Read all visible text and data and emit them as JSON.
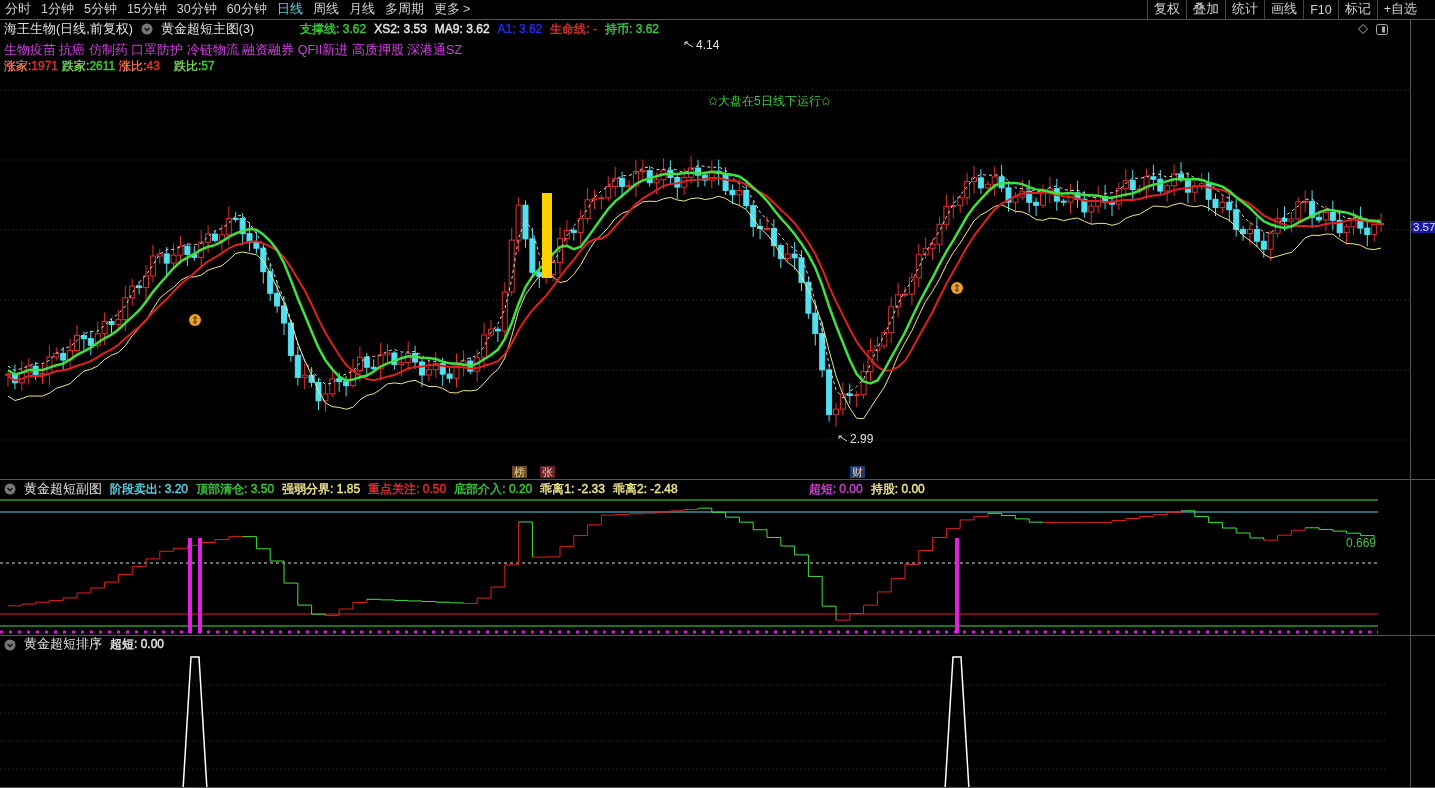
{
  "period_tabs": [
    {
      "label": "分时",
      "selected": false
    },
    {
      "label": "1分钟",
      "selected": false
    },
    {
      "label": "5分钟",
      "selected": false
    },
    {
      "label": "15分钟",
      "selected": false
    },
    {
      "label": "30分钟",
      "selected": false
    },
    {
      "label": "60分钟",
      "selected": false
    },
    {
      "label": "日线",
      "selected": true
    },
    {
      "label": "周线",
      "selected": false
    },
    {
      "label": "月线",
      "selected": false
    },
    {
      "label": "多周期",
      "selected": false
    },
    {
      "label": "更多 >",
      "selected": false
    }
  ],
  "toolbar_buttons": [
    "复权",
    "叠加",
    "统计",
    "画线",
    "F10",
    "标记",
    "+自选"
  ],
  "main_chart": {
    "stock_title": "海王生物(日线,前复权)",
    "indicator_name": "黄金超短主图(3)",
    "legend": [
      {
        "label": "支撑线:",
        "value": "3.62",
        "color": "#3cc83c"
      },
      {
        "label": "XS2:",
        "value": "3.53",
        "color": "#e6e6e6"
      },
      {
        "label": "MA9:",
        "value": "3.62",
        "color": "#e6e6e6"
      },
      {
        "label": "A1:",
        "value": "3.62",
        "color": "#2a2ae6"
      },
      {
        "label": "生命线:",
        "value": "-",
        "color": "#e03030"
      },
      {
        "label": "持币:",
        "value": "3.62",
        "color": "#3cc83c"
      }
    ],
    "concepts": "生物疫苗 抗癌 仿制药 口罩防护 冷链物流 融资融券 QFII新进 高质押股 深港通SZ",
    "breadth": [
      {
        "label": "涨家:",
        "value": "1971",
        "color": "#e03030"
      },
      {
        "label": "跌家:",
        "value": "2611",
        "color": "#3cc83c"
      },
      {
        "label": "涨比:",
        "value": "43",
        "color": "#e03030"
      },
      {
        "label": "跌比:",
        "value": "57",
        "color": "#3cc83c"
      }
    ],
    "high_label": "4.14",
    "low_label": "2.99",
    "notice": "✩大盘在5日线下运行✩",
    "price_tag": "3.57",
    "event_badges": [
      {
        "text": "榜",
        "color": "#6a4a22"
      },
      {
        "text": "张",
        "color": "#6a1e28"
      },
      {
        "text": "财",
        "color": "#1e3c6a"
      }
    ]
  },
  "sub_chart": {
    "indicator_name": "黄金超短副图",
    "legend": [
      {
        "label": "阶段卖出:",
        "value": "3.20",
        "color": "#5fd4e6"
      },
      {
        "label": "顶部清仓:",
        "value": "3.50",
        "color": "#3cc83c"
      },
      {
        "label": "强弱分界:",
        "value": "1.85",
        "color": "#f0e68c"
      },
      {
        "label": "重点关注:",
        "value": "0.50",
        "color": "#e03030"
      },
      {
        "label": "底部介入:",
        "value": "0.20",
        "color": "#3cc83c"
      },
      {
        "label": "乖离1:",
        "value": "-2.33",
        "color": "#f0e68c"
      },
      {
        "label": "乖离2:",
        "value": "-2.48",
        "color": "#f0e68c"
      }
    ],
    "legend_2": [
      {
        "label": "超短:",
        "value": "0.00",
        "color": "#d040d0"
      },
      {
        "label": "持股:",
        "value": "0.00",
        "color": "#f0e68c"
      }
    ],
    "axis_label": "0.669"
  },
  "rank_chart": {
    "indicator_name": "黄金超短排序",
    "legend": [
      {
        "label": "超短:",
        "value": "0.00",
        "color": "#e6e6e6"
      }
    ]
  }
}
